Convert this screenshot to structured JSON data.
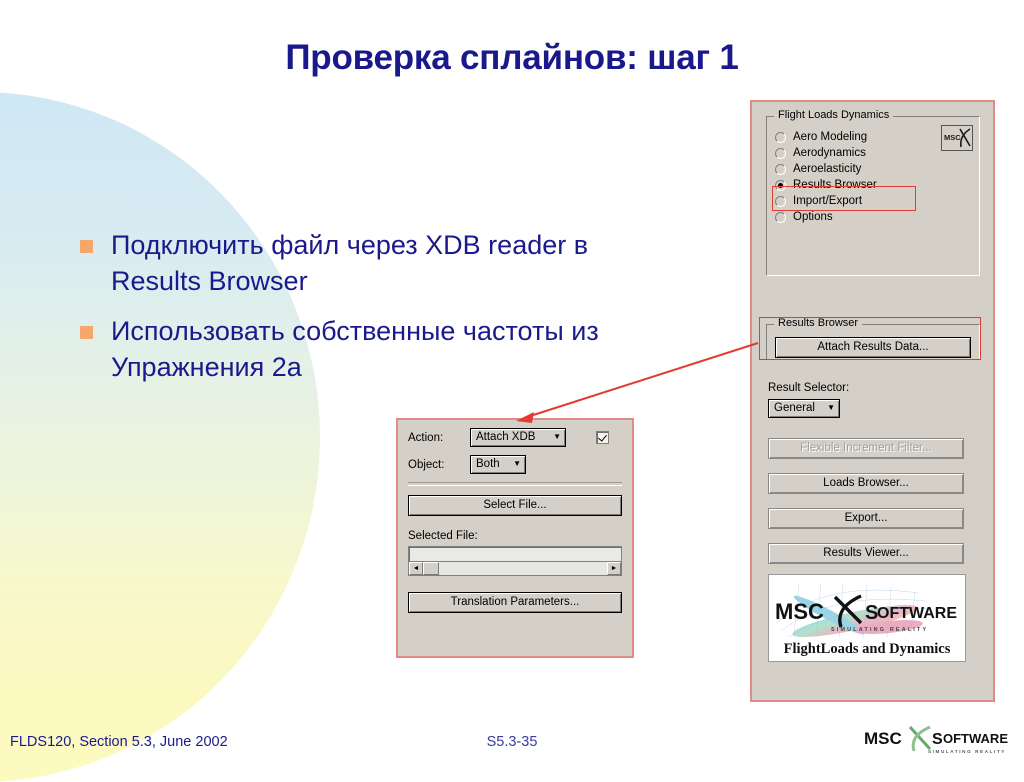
{
  "slide": {
    "title": "Проверка сплайнов: шаг 1",
    "bullets": [
      "Подключить файл через XDB reader в Results Browser",
      "Использовать собственные частоты из Упражнения 2а"
    ]
  },
  "footer": {
    "left": "FLDS120, Section 5.3, June 2002",
    "center": "S5.3-35",
    "logo_primary": "MSC",
    "logo_secondary": "SOFTWARE",
    "logo_tagline": "SIMULATING REALITY"
  },
  "right_panel": {
    "group_title": "Flight Loads  Dynamics",
    "radio_options": [
      {
        "label": "Aero Modeling",
        "selected": false
      },
      {
        "label": "Aerodynamics",
        "selected": false
      },
      {
        "label": "Aeroelasticity",
        "selected": false
      },
      {
        "label": "Results Browser",
        "selected": true
      },
      {
        "label": "Import/Export",
        "selected": false
      },
      {
        "label": "Options",
        "selected": false
      }
    ],
    "msc_badge": "MSC",
    "results_browser": {
      "group_title": "Results Browser",
      "attach_button": "Attach Results Data..."
    },
    "result_selector": {
      "label": "Result Selector:",
      "value": "General",
      "caret": "▼"
    },
    "buttons": [
      {
        "label": "Flexible Increment Filter...",
        "disabled": true
      },
      {
        "label": "Loads Browser...",
        "disabled": false
      },
      {
        "label": "Export...",
        "disabled": false
      },
      {
        "label": "Results Viewer...",
        "disabled": false
      }
    ],
    "logo_block": {
      "primary": "MSC",
      "secondary": "SOFTWARE",
      "tagline": "SIMULATING REALITY",
      "product": "FlightLoads and Dynamics"
    }
  },
  "xdb_dialog": {
    "action_label": "Action:",
    "action_value": "Attach XDB",
    "object_label": "Object:",
    "object_value": "Both",
    "caret": "▼",
    "select_file_button": "Select File...",
    "selected_file_label": "Selected File:",
    "selected_file_value": "",
    "translation_button": "Translation Parameters...",
    "scroll_left": "◄",
    "scroll_right": "►"
  },
  "colors": {
    "title_blue": "#19198c",
    "bullet_orange": "#f5a76c",
    "highlight_red": "#e23c32",
    "dialog_face": "#d4d0c8"
  }
}
